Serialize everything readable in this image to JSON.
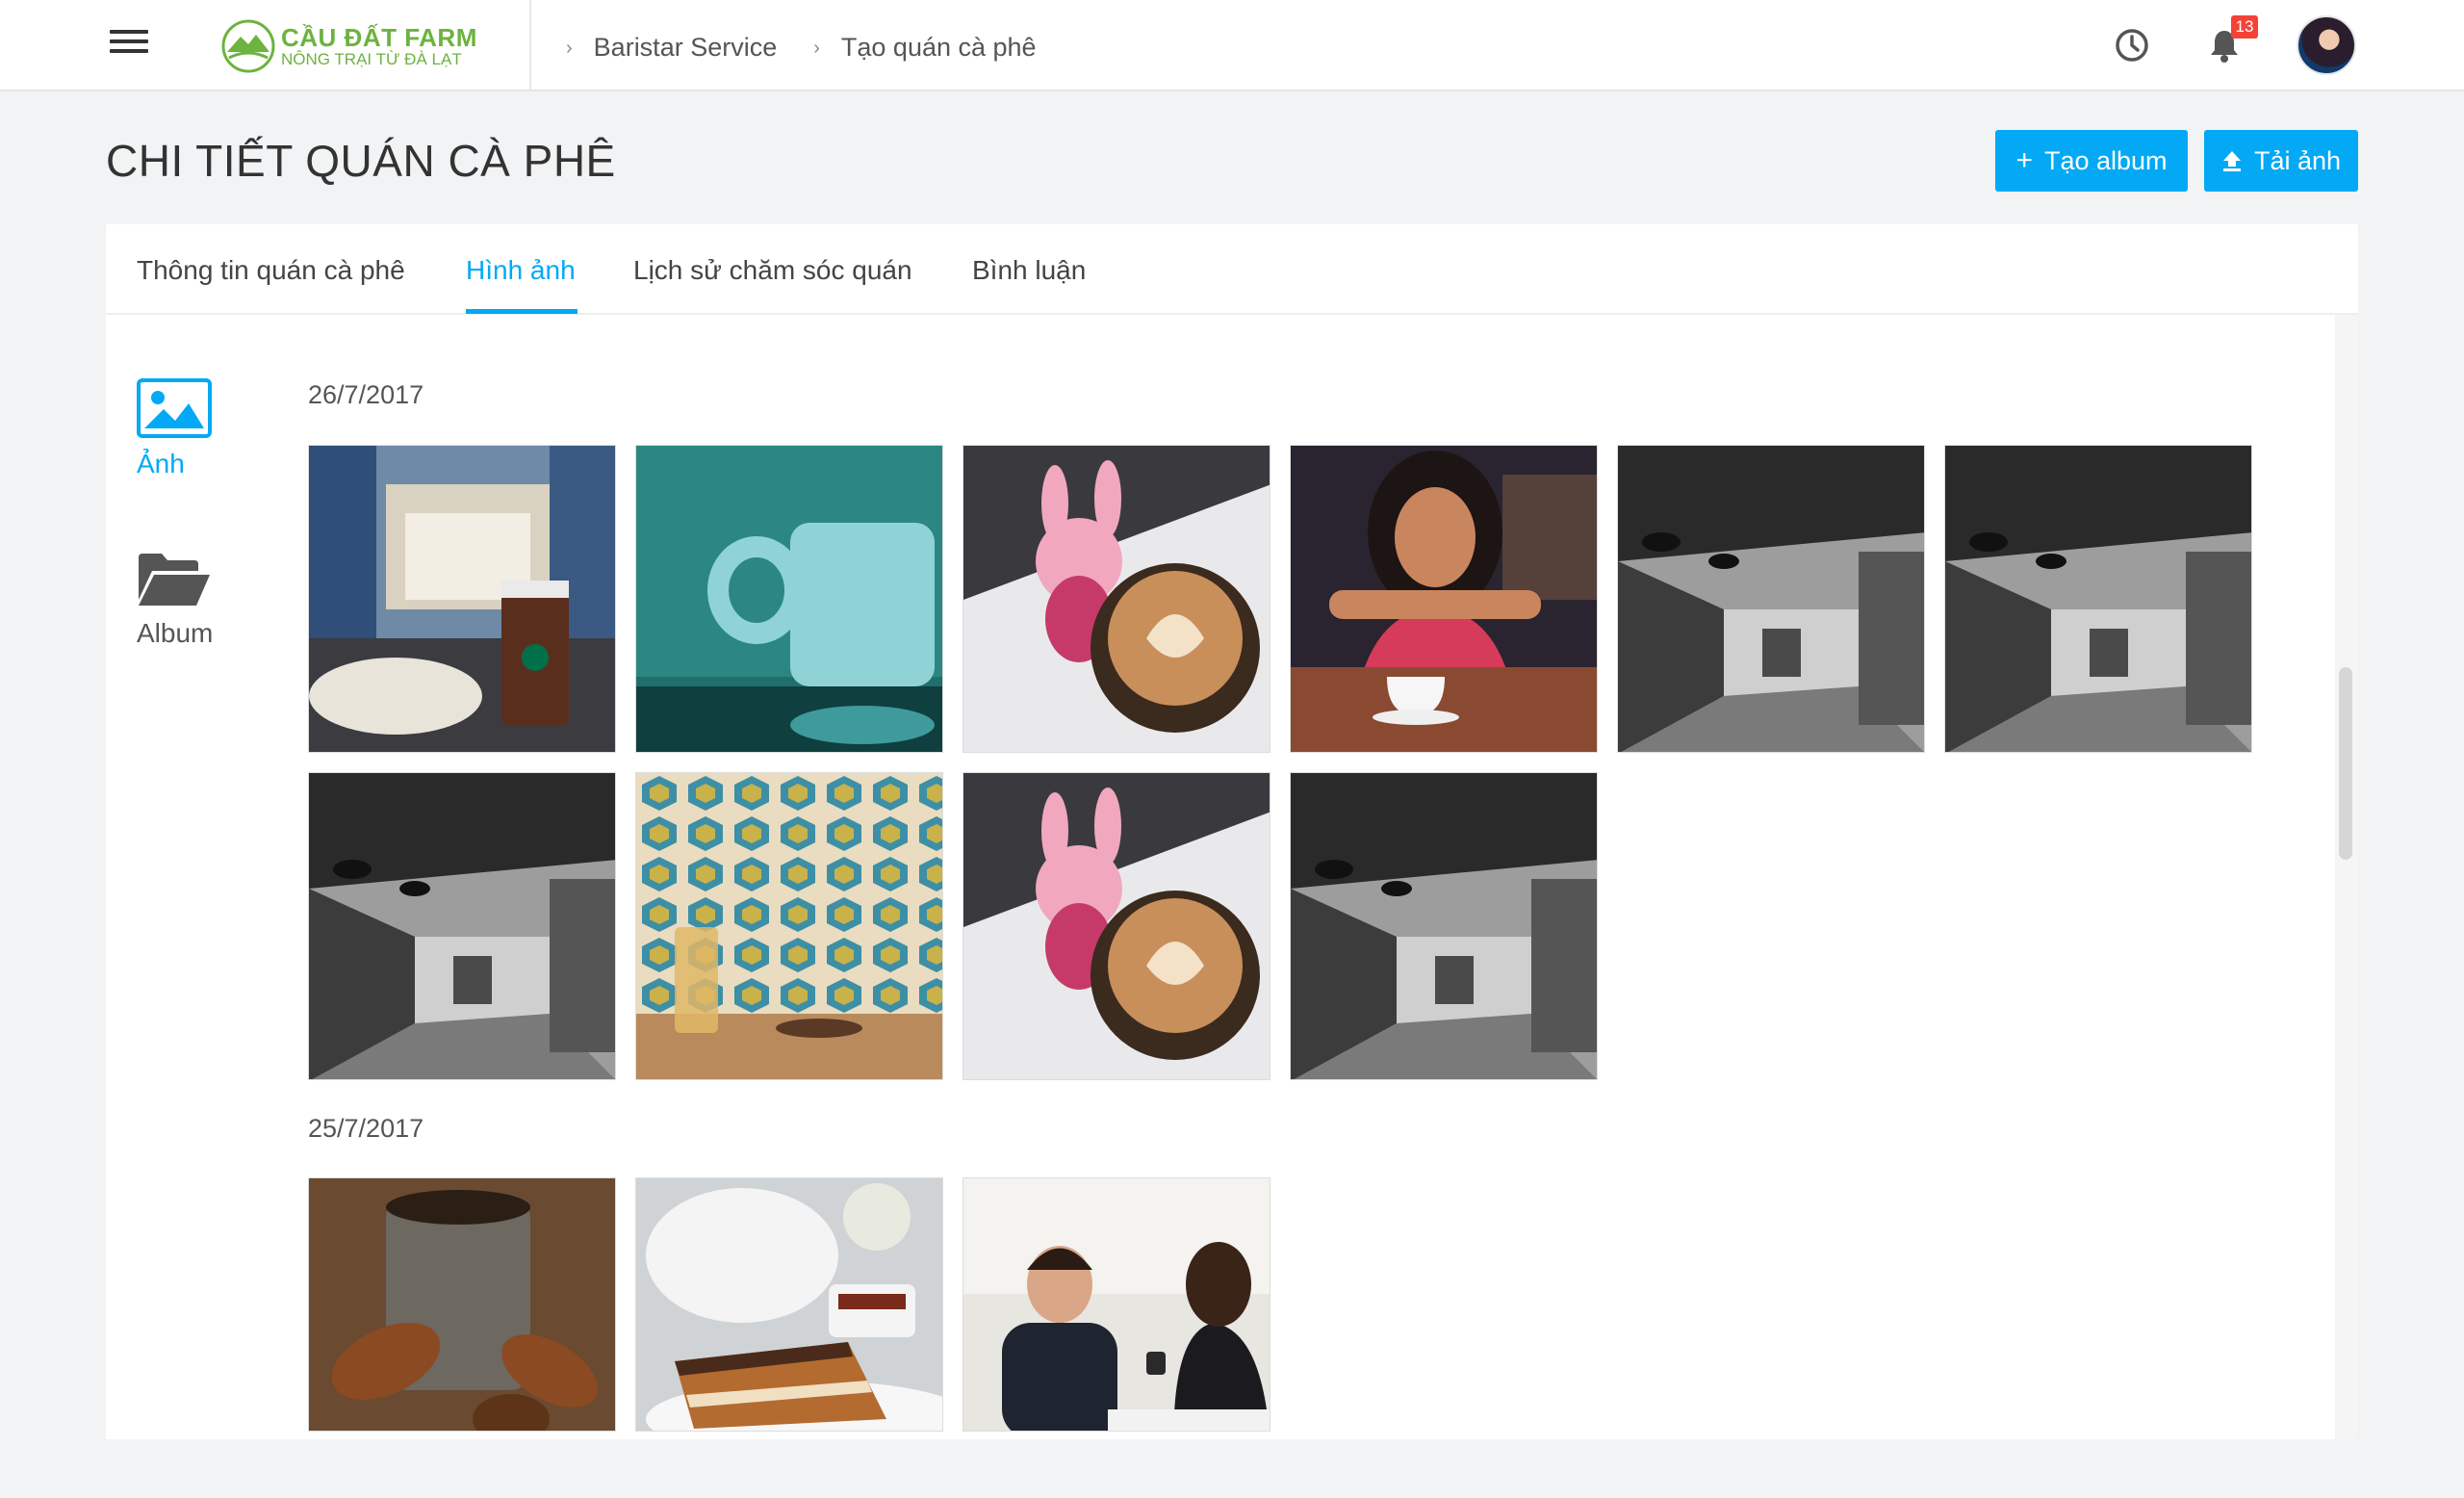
{
  "header": {
    "logo": {
      "title": "CẦU ĐẤT FARM",
      "subtitle": "NÔNG TRẠI TỪ ĐÀ LẠT"
    },
    "breadcrumb": [
      "Baristar Service",
      "Tạo quán cà phê"
    ],
    "notification_count": "13"
  },
  "page": {
    "title": "CHI TIẾT QUÁN CÀ PHÊ",
    "create_album_label": "Tạo album",
    "upload_label": "Tải ảnh"
  },
  "tabs": [
    {
      "label": "Thông tin quán cà phê"
    },
    {
      "label": "Hình ảnh",
      "active": true
    },
    {
      "label": "Lịch sử chăm sóc quán"
    },
    {
      "label": "Bình luận"
    }
  ],
  "sidebar": {
    "photos_label": "Ảnh",
    "album_label": "Album"
  },
  "gallery": [
    {
      "date": "26/7/2017",
      "photos": [
        "starbucks-breakfast",
        "teal-cup",
        "piglet-latte",
        "woman-coffee-cup",
        "bw-cafe-interior",
        "bw-cafe-interior",
        "bw-cafe-interior",
        "hexagon-tile-table",
        "piglet-latte",
        "bw-cafe-interior"
      ]
    },
    {
      "date": "25/7/2017",
      "photos": [
        "tea-pinecones",
        "teapot-cake",
        "couple-cafe"
      ]
    }
  ],
  "colors": {
    "accent": "#03a9f4",
    "logo_green": "#6cb33f",
    "badge": "#f44336"
  }
}
